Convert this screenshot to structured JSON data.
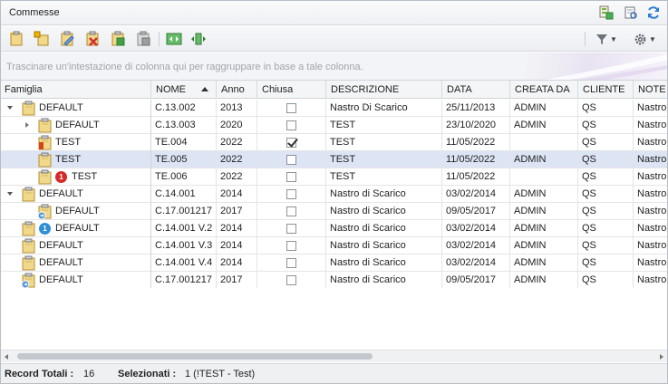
{
  "window": {
    "title": "Commesse"
  },
  "title_icons": [
    "tree-export-icon",
    "print-preview-icon",
    "refresh-icon"
  ],
  "toolbar": {
    "buttons": [
      "new-commessa-icon",
      "new-subcommessa-icon",
      "edit-icon",
      "delete-icon",
      "open-icon",
      "close-commessa-icon",
      "expand-all-icon",
      "collapse-all-icon"
    ],
    "filter_icon": "filter-icon",
    "settings_icon": "gear-icon"
  },
  "group_panel": {
    "hint": "Trascinare un'intestazione di colonna qui per raggruppare in base a tale colonna."
  },
  "columns": {
    "famiglia": "Famiglia",
    "nome": "NOME",
    "anno": "Anno",
    "chiusa": "Chiusa",
    "descrizione": "DESCRIZIONE",
    "data": "DATA",
    "creata_da": "CREATA DA",
    "cliente": "CLIENTE",
    "note": "NOTE"
  },
  "rows": [
    {
      "famiglia": "DEFAULT",
      "nome": "C.13.002",
      "anno": "2013",
      "chiusa": false,
      "descrizione": "Nastro Di Scarico",
      "data": "25/11/2013",
      "creata_da": "ADMIN",
      "cliente": "QS",
      "note": "Nastro"
    },
    {
      "famiglia": "DEFAULT",
      "nome": "C.13.003",
      "anno": "2020",
      "chiusa": false,
      "descrizione": "TEST",
      "data": "23/10/2020",
      "creata_da": "ADMIN",
      "cliente": "QS",
      "note": "Nastro"
    },
    {
      "famiglia": "TEST",
      "nome": "TE.004",
      "anno": "2022",
      "chiusa": true,
      "descrizione": "TEST",
      "data": "11/05/2022",
      "creata_da": "",
      "cliente": "QS",
      "note": "Nastro"
    },
    {
      "famiglia": "TEST",
      "nome": "TE.005",
      "anno": "2022",
      "chiusa": false,
      "descrizione": "TEST",
      "data": "11/05/2022",
      "creata_da": "ADMIN",
      "cliente": "QS",
      "note": "Nastro"
    },
    {
      "famiglia": "TEST",
      "nome": "TE.006",
      "anno": "2022",
      "chiusa": false,
      "descrizione": "TEST",
      "data": "11/05/2022",
      "creata_da": "",
      "cliente": "QS",
      "note": "Nastro"
    },
    {
      "famiglia": "DEFAULT",
      "nome": "C.14.001",
      "anno": "2014",
      "chiusa": false,
      "descrizione": "Nastro di Scarico",
      "data": "03/02/2014",
      "creata_da": "ADMIN",
      "cliente": "QS",
      "note": "Nastro"
    },
    {
      "famiglia": "DEFAULT",
      "nome": "C.17.001217",
      "anno": "2017",
      "chiusa": false,
      "descrizione": "Nastro di Scarico",
      "data": "09/05/2017",
      "creata_da": "ADMIN",
      "cliente": "QS",
      "note": "Nastro"
    },
    {
      "famiglia": "DEFAULT",
      "nome": "C.14.001 V.2",
      "anno": "2014",
      "chiusa": false,
      "descrizione": "Nastro di Scarico",
      "data": "03/02/2014",
      "creata_da": "ADMIN",
      "cliente": "QS",
      "note": "Nastro"
    },
    {
      "famiglia": "DEFAULT",
      "nome": "C.14.001 V.3",
      "anno": "2014",
      "chiusa": false,
      "descrizione": "Nastro di Scarico",
      "data": "03/02/2014",
      "creata_da": "ADMIN",
      "cliente": "QS",
      "note": "Nastro"
    },
    {
      "famiglia": "DEFAULT",
      "nome": "C.14.001 V.4",
      "anno": "2014",
      "chiusa": false,
      "descrizione": "Nastro di Scarico",
      "data": "03/02/2014",
      "creata_da": "ADMIN",
      "cliente": "QS",
      "note": "Nastro"
    },
    {
      "famiglia": "DEFAULT",
      "nome": "C.17.001217",
      "anno": "2017",
      "chiusa": false,
      "descrizione": "Nastro di Scarico",
      "data": "09/05/2017",
      "creata_da": "ADMIN",
      "cliente": "QS",
      "note": "Nastro"
    }
  ],
  "badges": {
    "red": "1",
    "blue": "1"
  },
  "status": {
    "total_label": "Record Totali :",
    "total_value": "16",
    "selected_label": "Selezionati :",
    "selected_value": "1 (!TEST - Test)"
  },
  "colors": {
    "selected_row": "#dde5f4",
    "badge_red": "#d42a2a",
    "badge_blue": "#2f8fd6",
    "folder": "#e8c874"
  }
}
